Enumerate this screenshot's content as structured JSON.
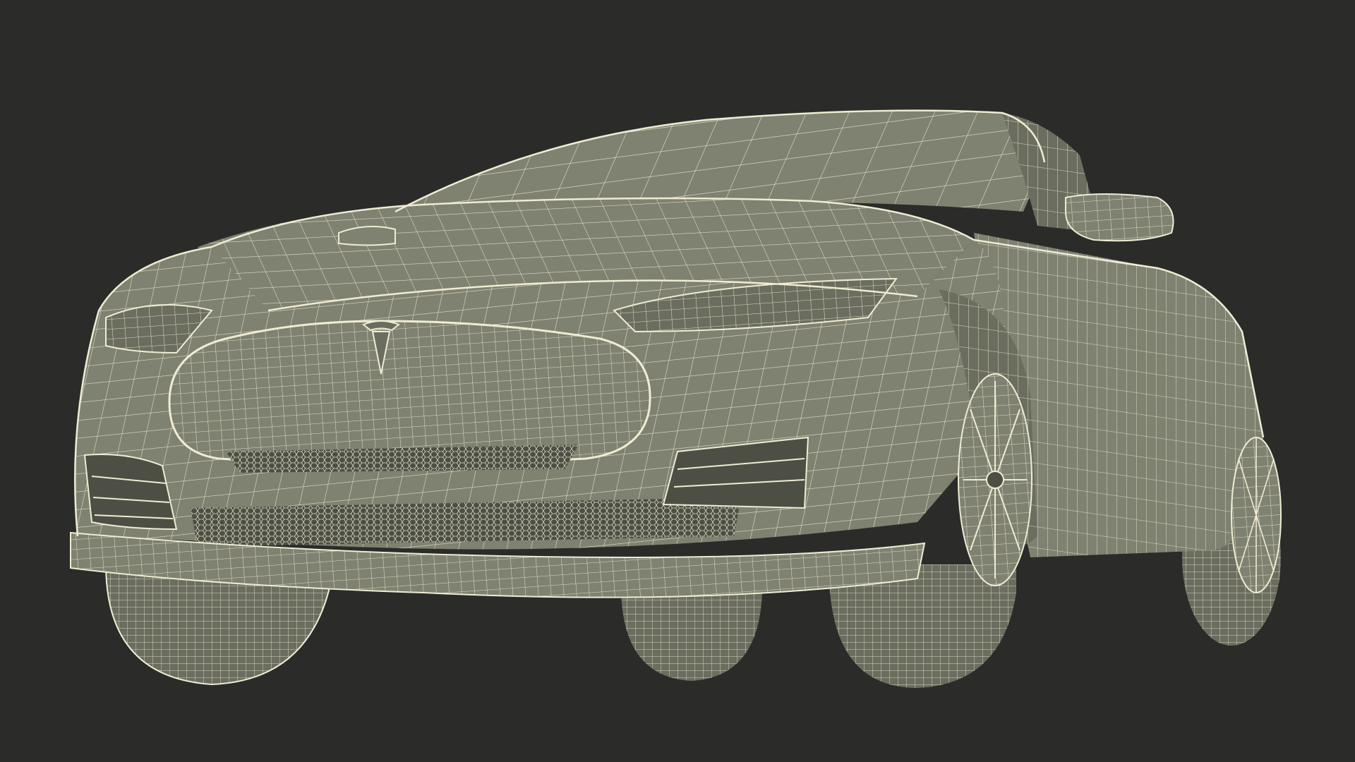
{
  "scene": {
    "subject": "car-wireframe-render",
    "background_color": "#2b2b2a",
    "body_color": "#7f8171",
    "body_shade_color": "#6b6d5f",
    "dark_color": "#4d4f45",
    "wire_color": "#efecd3",
    "emblem_icon": "car-brand-emblem-icon"
  }
}
